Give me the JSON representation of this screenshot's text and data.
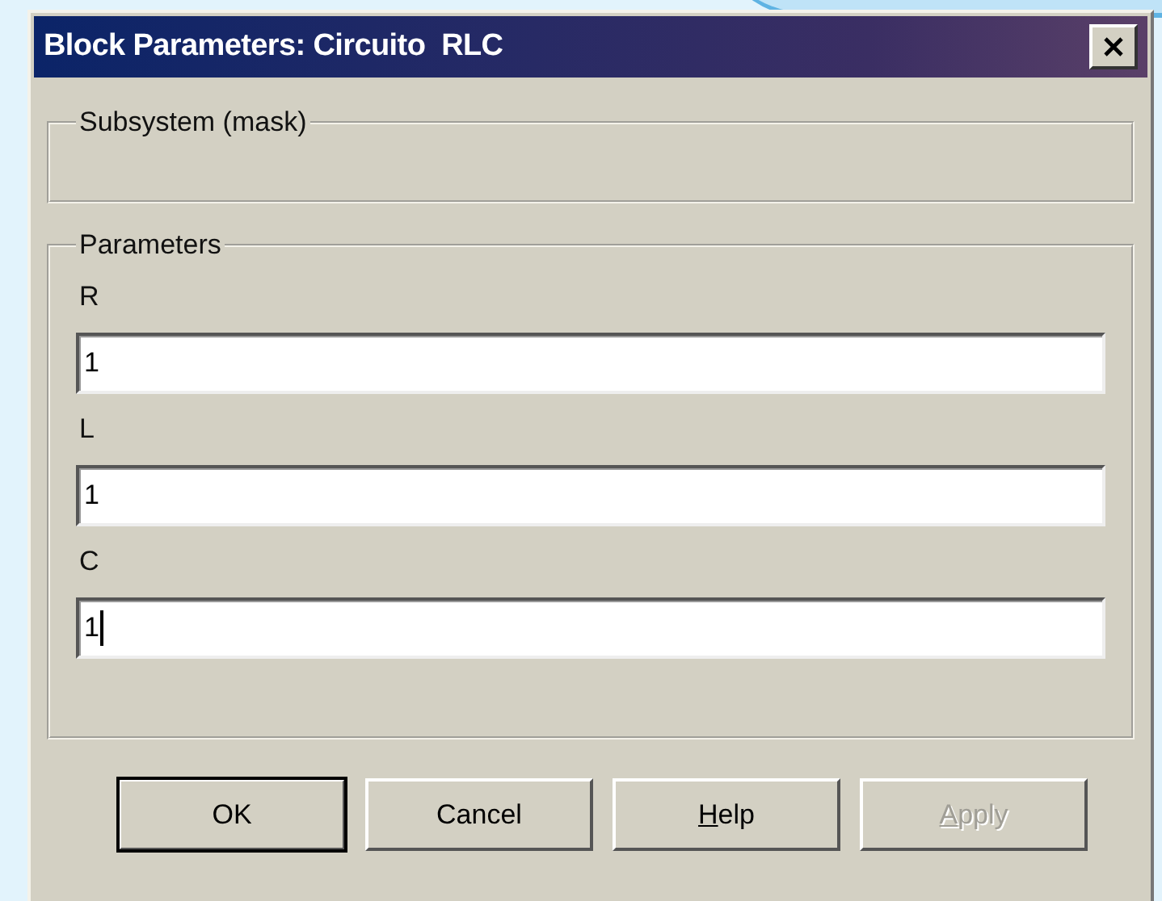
{
  "window": {
    "title": "Block Parameters: Circuito  RLC"
  },
  "subsystem_group": {
    "label": "Subsystem (mask)"
  },
  "parameters_group": {
    "label": "Parameters",
    "fields": [
      {
        "label": "R",
        "value": "1",
        "focused": false
      },
      {
        "label": "L",
        "value": "1",
        "focused": false
      },
      {
        "label": "C",
        "value": "1",
        "focused": true
      }
    ]
  },
  "buttons": [
    {
      "label": "OK",
      "default": true,
      "disabled": false,
      "mnemonic": false
    },
    {
      "label": "Cancel",
      "default": false,
      "disabled": false,
      "mnemonic": false
    },
    {
      "label": "Help",
      "default": false,
      "disabled": false,
      "mnemonic": true
    },
    {
      "label": "Apply",
      "default": false,
      "disabled": true,
      "mnemonic": true
    }
  ]
}
